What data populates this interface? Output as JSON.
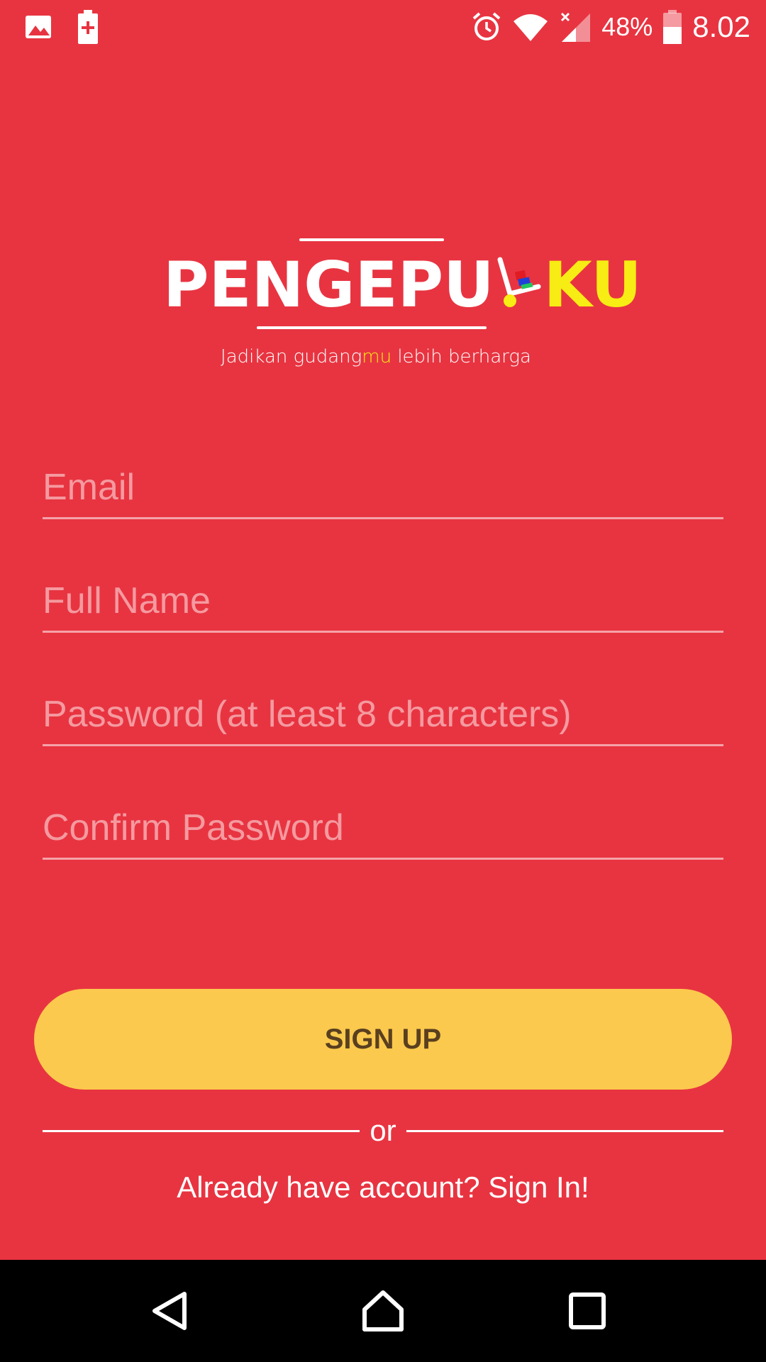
{
  "status_bar": {
    "icons_left": [
      "gallery-icon",
      "battery-saver-icon"
    ],
    "icons_right": [
      "alarm-icon",
      "wifi-icon",
      "signal-icon"
    ],
    "battery_percent": "48%",
    "time": "8.02"
  },
  "logo": {
    "brand_part1": "PENGEPU",
    "brand_part2": "KU",
    "tagline_pre": "Jadikan gudang",
    "tagline_highlight": "mu",
    "tagline_post": " lebih berharga"
  },
  "form": {
    "email_placeholder": "Email",
    "fullname_placeholder": "Full Name",
    "password_placeholder": "Password (at least 8 characters)",
    "confirm_placeholder": "Confirm Password"
  },
  "actions": {
    "signup_label": "SIGN UP",
    "or_label": "or",
    "signin_label": "Already have account? Sign In!"
  },
  "colors": {
    "background": "#e83441",
    "button": "#fbc94d",
    "button_text": "#5a3f1f",
    "accent_yellow": "#f7ec13"
  },
  "nav_bar": {
    "buttons": [
      "back-icon",
      "home-icon",
      "recents-icon"
    ]
  }
}
